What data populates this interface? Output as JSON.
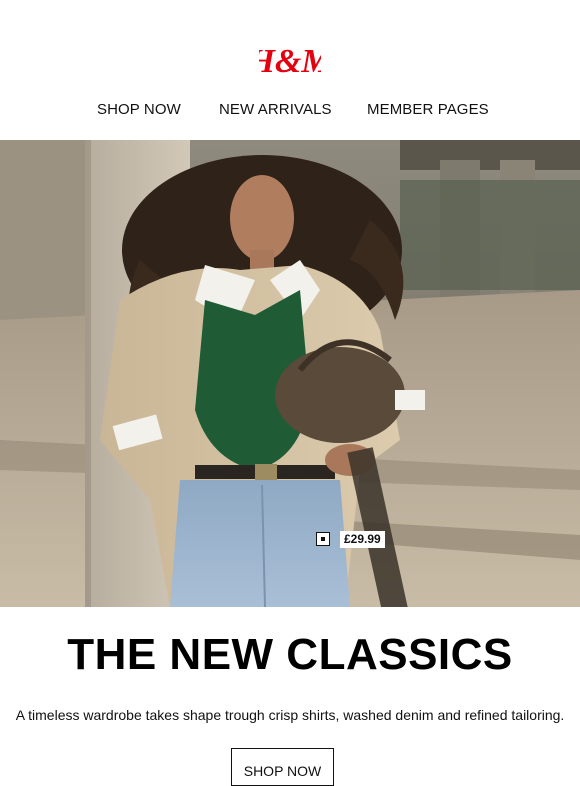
{
  "brand": {
    "logo_text": "H&M",
    "logo_color": "#e50010"
  },
  "nav": {
    "items": [
      "SHOP NOW",
      "NEW ARRIVALS",
      "MEMBER PAGES"
    ]
  },
  "hero": {
    "price_tag": "£29.99"
  },
  "campaign": {
    "headline": "THE NEW CLASSICS",
    "description": "A timeless wardrobe takes shape trough crisp shirts, washed denim and refined tailoring.",
    "cta_label": "SHOP NOW"
  }
}
